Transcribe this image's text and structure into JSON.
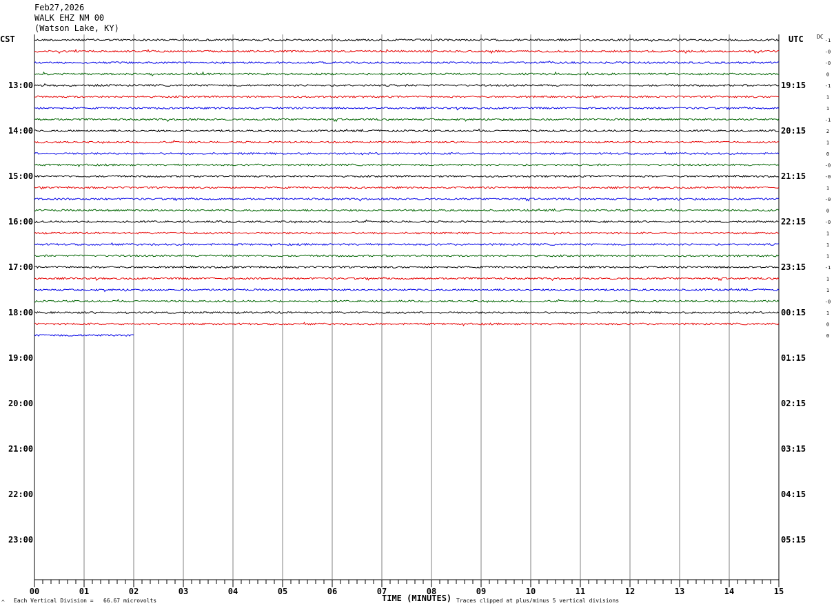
{
  "header": {
    "date": "Feb27,2026",
    "station": "WALK EHZ NM 00",
    "location": "(Watson Lake, KY)"
  },
  "left_zone_label": "CST",
  "right_zone_label": "UTC",
  "dc_label": "DC",
  "footer": {
    "mark": "^",
    "scale_text": "Each Vertical Division =   66.67 microvolts",
    "clip_text": "Traces clipped at plus/minus 5 vertical divisions"
  },
  "colors": {
    "trace_cycle": [
      "#000000",
      "#e60000",
      "#0000e6",
      "#006400"
    ],
    "grid": "#808080"
  },
  "chart_data": {
    "type": "line",
    "title": "",
    "xlabel": "TIME (MINUTES)",
    "ylabel": "",
    "xlim": [
      0,
      15
    ],
    "x_ticks": [
      "00",
      "01",
      "02",
      "03",
      "04",
      "05",
      "06",
      "07",
      "08",
      "09",
      "10",
      "11",
      "12",
      "13",
      "14",
      "15"
    ],
    "rows_per_hour": 4,
    "left_hour_labels": [
      "13:00",
      "14:00",
      "15:00",
      "16:00",
      "17:00",
      "18:00",
      "19:00",
      "20:00",
      "21:00",
      "22:00",
      "23:00"
    ],
    "right_hour_labels": [
      "19:15",
      "20:15",
      "21:15",
      "22:15",
      "23:15",
      "00:15",
      "01:15",
      "02:15",
      "03:15",
      "04:15",
      "05:15"
    ],
    "traces": [
      {
        "row": 0,
        "color": "black",
        "dc": "-1",
        "end_minute": 15
      },
      {
        "row": 1,
        "color": "red",
        "dc": "-0",
        "end_minute": 15
      },
      {
        "row": 2,
        "color": "blue",
        "dc": "-0",
        "end_minute": 15
      },
      {
        "row": 3,
        "color": "green",
        "dc": "0",
        "end_minute": 15
      },
      {
        "row": 4,
        "color": "black",
        "dc": "-1",
        "end_minute": 15
      },
      {
        "row": 5,
        "color": "red",
        "dc": "1",
        "end_minute": 15
      },
      {
        "row": 6,
        "color": "blue",
        "dc": "1",
        "end_minute": 15
      },
      {
        "row": 7,
        "color": "green",
        "dc": "-1",
        "end_minute": 15
      },
      {
        "row": 8,
        "color": "black",
        "dc": "2",
        "end_minute": 15
      },
      {
        "row": 9,
        "color": "red",
        "dc": "1",
        "end_minute": 15
      },
      {
        "row": 10,
        "color": "blue",
        "dc": "0",
        "end_minute": 15
      },
      {
        "row": 11,
        "color": "green",
        "dc": "-0",
        "end_minute": 15
      },
      {
        "row": 12,
        "color": "black",
        "dc": "-0",
        "end_minute": 15
      },
      {
        "row": 13,
        "color": "red",
        "dc": "1",
        "end_minute": 15
      },
      {
        "row": 14,
        "color": "blue",
        "dc": "-0",
        "end_minute": 15
      },
      {
        "row": 15,
        "color": "green",
        "dc": "0",
        "end_minute": 15
      },
      {
        "row": 16,
        "color": "black",
        "dc": "-0",
        "end_minute": 15
      },
      {
        "row": 17,
        "color": "red",
        "dc": "1",
        "end_minute": 15
      },
      {
        "row": 18,
        "color": "blue",
        "dc": "1",
        "end_minute": 15
      },
      {
        "row": 19,
        "color": "green",
        "dc": "1",
        "end_minute": 15
      },
      {
        "row": 20,
        "color": "black",
        "dc": "-1",
        "end_minute": 15
      },
      {
        "row": 21,
        "color": "red",
        "dc": "1",
        "end_minute": 15
      },
      {
        "row": 22,
        "color": "blue",
        "dc": "1",
        "end_minute": 15
      },
      {
        "row": 23,
        "color": "green",
        "dc": "-0",
        "end_minute": 15
      },
      {
        "row": 24,
        "color": "black",
        "dc": "1",
        "end_minute": 15
      },
      {
        "row": 25,
        "color": "red",
        "dc": "0",
        "end_minute": 15
      },
      {
        "row": 26,
        "color": "blue",
        "dc": "0",
        "end_minute": 2
      }
    ]
  }
}
